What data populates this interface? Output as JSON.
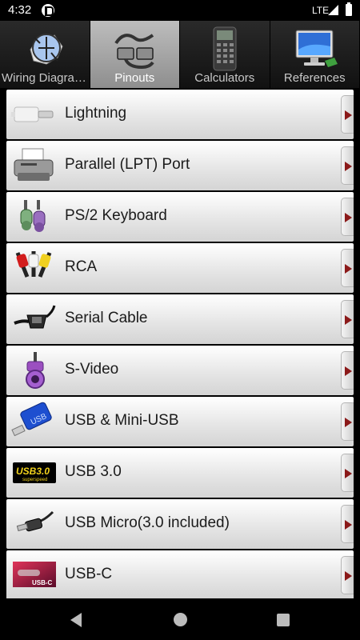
{
  "status_bar": {
    "time": "4:32",
    "network": "LTE",
    "icons": [
      "notification-icon",
      "signal-icon",
      "battery-icon"
    ]
  },
  "tabs": [
    {
      "label": "Wiring Diagram..",
      "icon": "wiring-diagram-icon",
      "active": false
    },
    {
      "label": "Pinouts",
      "icon": "pinouts-connector-icon",
      "active": true
    },
    {
      "label": "Calculators",
      "icon": "calculator-icon",
      "active": false
    },
    {
      "label": "References",
      "icon": "monitor-icon",
      "active": false
    }
  ],
  "list": {
    "items": [
      {
        "label": "Lightning",
        "icon": "lightning-cable-icon"
      },
      {
        "label": "Parallel (LPT) Port",
        "icon": "printer-icon"
      },
      {
        "label": "PS/2 Keyboard",
        "icon": "ps2-connector-icon"
      },
      {
        "label": "RCA",
        "icon": "rca-plugs-icon"
      },
      {
        "label": "Serial Cable",
        "icon": "serial-cable-icon"
      },
      {
        "label": "S-Video",
        "icon": "s-video-plug-icon"
      },
      {
        "label": "USB & Mini-USB",
        "icon": "usb-stick-icon"
      },
      {
        "label": "USB 3.0",
        "icon": "usb3-logo-icon",
        "logo_text": "USB3.0",
        "logo_subtext": "superspeed"
      },
      {
        "label": "USB Micro(3.0 included)",
        "icon": "usb-micro-cable-icon"
      },
      {
        "label": "USB-C",
        "icon": "usb-c-icon",
        "logo_text": "USB-C"
      }
    ],
    "arrow_icon": "chevron-right-icon",
    "arrow_color": "#8b1a1a"
  },
  "nav_bar": {
    "icons": [
      "back-icon",
      "home-icon",
      "recents-icon"
    ]
  },
  "colors": {
    "active_tab": "#a8a8a8",
    "tab_bar": "#1c1c1c",
    "row_background": "#e6e6e6",
    "background": "#000000"
  }
}
